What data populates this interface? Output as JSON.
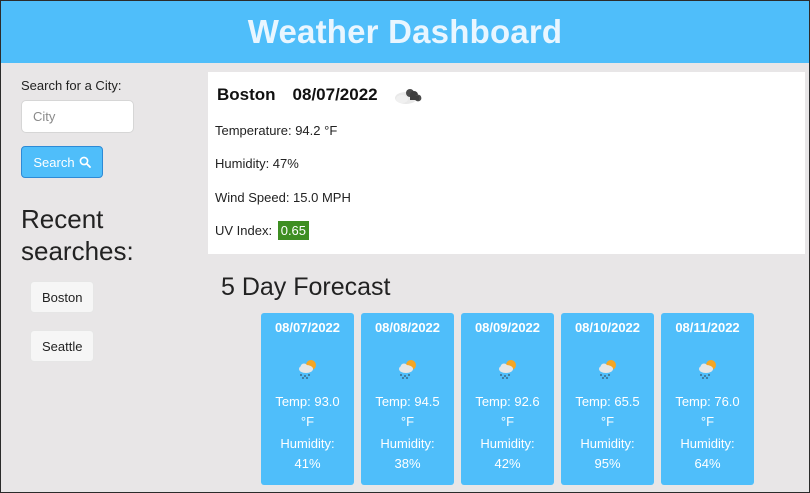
{
  "header": {
    "title": "Weather Dashboard"
  },
  "sidebar": {
    "search_label": "Search for a City:",
    "input_placeholder": "City",
    "input_value": "",
    "search_button": "Search",
    "recent_title": "Recent searches:",
    "recent": [
      "Boston",
      "Seattle"
    ]
  },
  "current": {
    "city": "Boston",
    "date": "08/07/2022",
    "icon": "broken-clouds-icon",
    "temperature": "Temperature: 94.2 °F",
    "humidity": "Humidity: 47%",
    "wind": "Wind Speed: 15.0 MPH",
    "uv_label": "UV Index:",
    "uv_value": "0.65",
    "uv_color": "#3e8e22"
  },
  "forecast": {
    "title": "5 Day Forecast",
    "days": [
      {
        "date": "08/07/2022",
        "icon": "rain-sun-icon",
        "temp": "Temp: 93.0 °F",
        "humidity_label": "Humidity:",
        "humidity": "41%"
      },
      {
        "date": "08/08/2022",
        "icon": "rain-sun-icon",
        "temp": "Temp: 94.5 °F",
        "humidity_label": "Humidity:",
        "humidity": "38%"
      },
      {
        "date": "08/09/2022",
        "icon": "rain-sun-icon",
        "temp": "Temp: 92.6 °F",
        "humidity_label": "Humidity:",
        "humidity": "42%"
      },
      {
        "date": "08/10/2022",
        "icon": "rain-sun-icon",
        "temp": "Temp: 65.5 °F",
        "humidity_label": "Humidity:",
        "humidity": "95%"
      },
      {
        "date": "08/11/2022",
        "icon": "rain-sun-icon",
        "temp": "Temp: 76.0 °F",
        "humidity_label": "Humidity:",
        "humidity": "64%"
      }
    ]
  },
  "colors": {
    "accent": "#4fbefa",
    "background": "#e8e6e7"
  }
}
